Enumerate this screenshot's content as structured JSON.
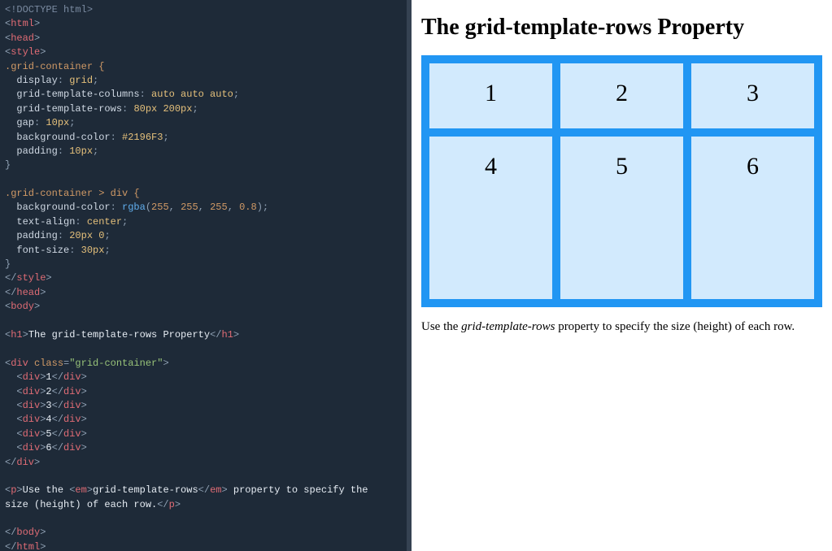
{
  "code": {
    "doctype": "<!DOCTYPE html>",
    "html_open": "html",
    "head_open": "head",
    "style_open": "style",
    "css_sel1": ".grid-container {",
    "css_p1": "  display",
    "css_v1": "grid",
    "css_p2": "  grid-template-columns",
    "css_v2": "auto auto auto",
    "css_p3": "  grid-template-rows",
    "css_v3": "80px 200px",
    "css_p4": "  gap",
    "css_v4": "10px",
    "css_p5": "  background-color",
    "css_v5": "#2196F3",
    "css_p6": "  padding",
    "css_v6": "10px",
    "css_close1": "}",
    "css_sel2": ".grid-container > div {",
    "css_p7": "  background-color",
    "css_v7a": "rgba",
    "css_v7b": "255",
    "css_v7c": "255",
    "css_v7d": "255",
    "css_v7e": "0.8",
    "css_p8": "  text-align",
    "css_v8": "center",
    "css_p9": "  padding",
    "css_v9": "20px 0",
    "css_p10": "  font-size",
    "css_v10": "30px",
    "css_close2": "}",
    "style_close": "style",
    "head_close": "head",
    "body_open": "body",
    "h1_tag": "h1",
    "h1_text": "The grid-template-rows Property",
    "div_tag": "div",
    "class_attr": "class",
    "class_val": "\"grid-container\"",
    "cell1": "1",
    "cell2": "2",
    "cell3": "3",
    "cell4": "4",
    "cell5": "5",
    "cell6": "6",
    "p_tag": "p",
    "em_tag": "em",
    "p_text1": "Use the ",
    "p_em": "grid-template-rows",
    "p_text2": " property to specify the ",
    "p_text3": "size (height) of each row.",
    "body_close": "body",
    "html_close": "html"
  },
  "preview": {
    "heading": "The grid-template-rows Property",
    "cells": [
      "1",
      "2",
      "3",
      "4",
      "5",
      "6"
    ],
    "para_before": "Use the ",
    "para_em": "grid-template-rows",
    "para_after": " property to specify the size (height) of each row."
  }
}
